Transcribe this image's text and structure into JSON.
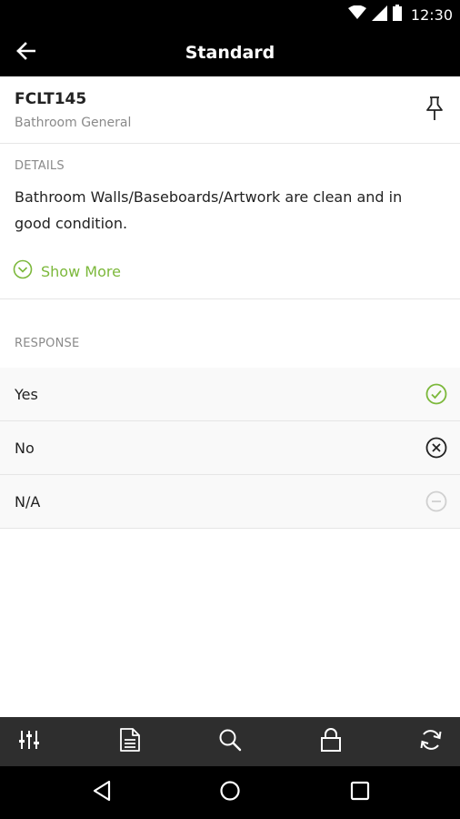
{
  "status_bar": {
    "time": "12:30",
    "icons": [
      "wifi-icon",
      "cell-signal-icon",
      "battery-icon"
    ]
  },
  "app_bar": {
    "title": "Standard",
    "back_icon": "arrow-left-icon"
  },
  "item": {
    "code": "FCLT145",
    "category": "Bathroom General",
    "pin_icon": "pushpin-icon"
  },
  "details": {
    "label": "DETAILS",
    "text": "Bathroom Walls/Baseboards/Artwork are clean and in good condition.",
    "show_more_label": "Show More"
  },
  "response": {
    "label": "RESPONSE",
    "options": [
      {
        "label": "Yes",
        "icon": "check-circle-icon",
        "color": "#7cb83b"
      },
      {
        "label": "No",
        "icon": "x-circle-icon",
        "color": "#222222"
      },
      {
        "label": "N/A",
        "icon": "minus-circle-icon",
        "color": "#d0d0d0"
      }
    ]
  },
  "toolbar": {
    "icons": [
      "sliders-icon",
      "document-icon",
      "search-icon",
      "lock-icon",
      "refresh-icon"
    ]
  },
  "nav": {
    "icons": [
      "back-triangle-icon",
      "home-circle-icon",
      "recents-square-icon"
    ]
  },
  "colors": {
    "accent": "#7cb83b",
    "bar_bg": "#000000",
    "toolbar_bg": "#2e2e2e"
  }
}
